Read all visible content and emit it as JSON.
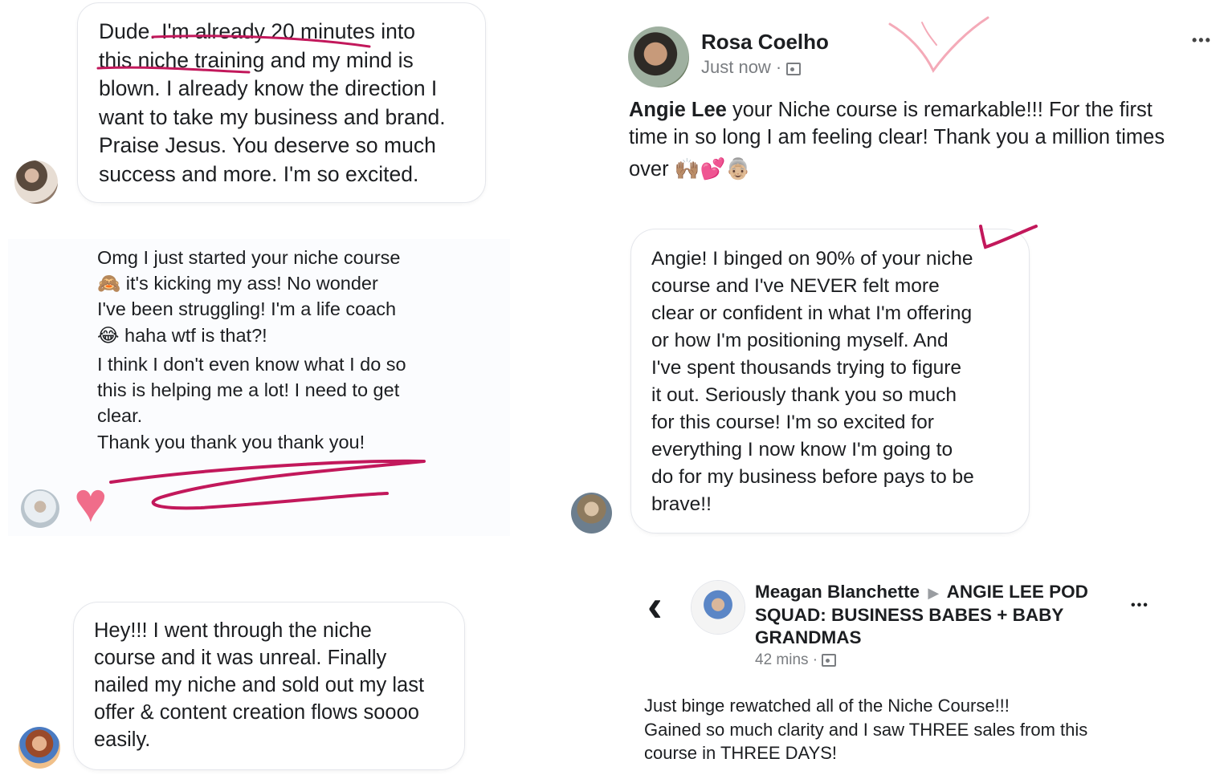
{
  "testimonial1": {
    "text": "Dude. I'm already 20 minutes into\nthis niche training and my mind is\nblown. I already know the direction I\nwant to take my business and brand.\nPraise Jesus. You deserve so much\nsuccess and more. I'm so excited."
  },
  "testimonial2": {
    "line1": "Omg I just started your niche course",
    "line2": "it's kicking my ass! No wonder",
    "line3": "I've been struggling! I'm a life coach",
    "line4": "haha wtf is that?!",
    "line5": "I think I don't even know what I do so\nthis is helping me a lot! I need to get\nclear.",
    "line6": "Thank you thank you thank you!",
    "emoji1": "🙈",
    "emoji2": "😂",
    "reaction": "♥"
  },
  "testimonial3": {
    "text": "Hey!!! I went through the niche\ncourse and it was unreal. Finally\nnailed my niche and sold out my last\noffer & content creation flows soooo\neasily."
  },
  "post1": {
    "author": "Rosa Coelho",
    "time": "Just now ·",
    "mention": "Angie Lee",
    "body_line1": " your Niche course is remarkable!!! For the first",
    "body_line2": "time in so long I am feeling clear! Thank you a million times",
    "body_line3": "over ",
    "emojis": "🙌🏽💕👵🏼",
    "more": "•••"
  },
  "testimonial4": {
    "text": "Angie! I binged on 90% of your niche\ncourse and I've NEVER felt more\nclear or confident in what I'm offering\nor how I'm positioning myself. And\nI've spent thousands trying to figure\nit out. Seriously thank you so much\nfor this course! I'm so excited for\neverything I now know I'm going to\ndo for my business before pays to be\nbrave!!"
  },
  "post2": {
    "back": "‹",
    "author": "Meagan Blanchette",
    "arrow": "▶",
    "group_line1": "ANGIE LEE POD",
    "group_line2": "SQUAD: BUSINESS BABES + BABY",
    "group_line3": "GRANDMAS",
    "time": "42 mins ·",
    "more": "•••",
    "body": "Just binge rewatched all of the Niche Course!!!\nGained so much clarity and I saw THREE sales from this\ncourse in THREE DAYS!"
  },
  "colors": {
    "underline": "#c2185b",
    "heart": "#f06d8a",
    "muted": "#7a7d81"
  }
}
